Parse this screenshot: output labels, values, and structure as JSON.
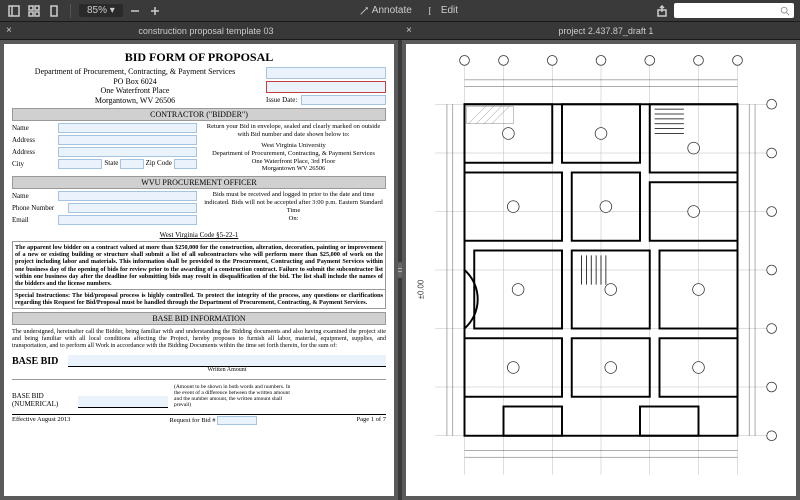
{
  "toolbar": {
    "zoom": "85%",
    "annotate": "Annotate",
    "edit": "Edit"
  },
  "tabs": {
    "left": "construction proposal template 03",
    "right": "project 2.437.87_draft 1"
  },
  "doc": {
    "title": "BID FORM OF PROPOSAL",
    "dept": "Department of Procurement, Contracting, & Payment Services",
    "po": "PO Box 6024",
    "addr1": "One Waterfront Place",
    "addr2": "Morgantown, WV 26506",
    "issue_date_label": "Issue Date:",
    "sec_contractor": "CONTRACTOR (\"BIDDER\")",
    "labels": {
      "name": "Name",
      "address": "Address",
      "city": "City",
      "state": "State",
      "zip": "Zip Code",
      "phone": "Phone Number",
      "email": "Email"
    },
    "return_text": "Return your Bid in envelope, sealed and clearly marked on outside with Bid number and date shown below to:",
    "uni": "West Virginia University",
    "dept2": "Department of Procurement, Contracting, & Payment Services",
    "floor": "One Waterfront Place, 3rd Floor",
    "city2": "Morgantown WV 26506",
    "deadline": "Bids must be received and logged in prior to the date and time indicated. Bids will not be accepted after 3:00 p.m. Eastern Standard Time",
    "on": "On:",
    "sec_officer": "WVU PROCUREMENT OFFICER",
    "code": "West Virginia Code §5-22-1",
    "legal1": "The apparent low bidder on a contract valued at more than $250,000 for the construction, alteration, decoration, painting or improvement of a new or existing building or structure shall submit a list of all subcontractors who will perform more than $25,000 of work on the project including labor and materials. This information shall be provided to the Procurement, Contracting and Payment Services within one business day of the opening of bids for review prior to the awarding of a construction contract. Failure to submit the subcontractor list within one business day after the deadline for submitting bids may result in disqualification of the bid. The list shall include the names of the bidders and the license numbers.",
    "legal2": "Special Instructions: The bid/proposal process is highly controlled. To protect the integrity of the process, any questions or clarifications regarding this Request for Bid/Proposal must be handled through the Department of Procurement, Contracting, & Payment Services.",
    "sec_basebid": "BASE BID INFORMATION",
    "legal3": "The undersigned, hereinafter call the Bidder, being familiar with and understanding the Bidding documents and also having examined the project site and being familiar with all local conditions affecting the Project, hereby proposes to furnish all labor, material, equipment, supplies, and transportation, and to perform all Work in accordance with the Bidding Documents within the time set forth therein, for the sum of:",
    "base_bid": "BASE BID",
    "written_amount": "Written Amount",
    "base_bid_num": "BASE BID (NUMERICAL)",
    "num_note": "(Amount to be shown in both words and numbers. In the event of a difference between the written amount and the number amount, the written amount shall prevail)",
    "effective": "Effective August 2013",
    "request_bid": "Request for Bid #",
    "page": "Page 1 of 7"
  }
}
